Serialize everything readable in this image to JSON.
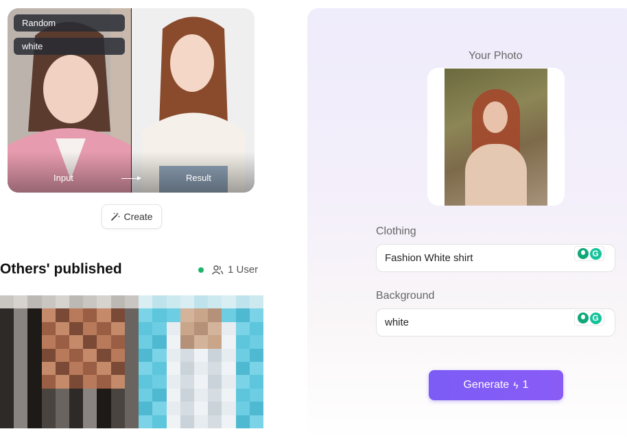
{
  "sample": {
    "tags": [
      "Random",
      "white"
    ],
    "input_caption": "Input",
    "result_caption": "Result"
  },
  "create_label": "Create",
  "others": {
    "title": "Others' published",
    "users": "1 User"
  },
  "right": {
    "photo_label": "Your Photo",
    "clothing_label": "Clothing",
    "clothing_value": "Fashion White shirt",
    "background_label": "Background",
    "background_value": "white",
    "generate_label": "Generate",
    "generate_cost": "1"
  },
  "colors": {
    "accent": "#7b5cf5",
    "online": "#1db46a"
  }
}
